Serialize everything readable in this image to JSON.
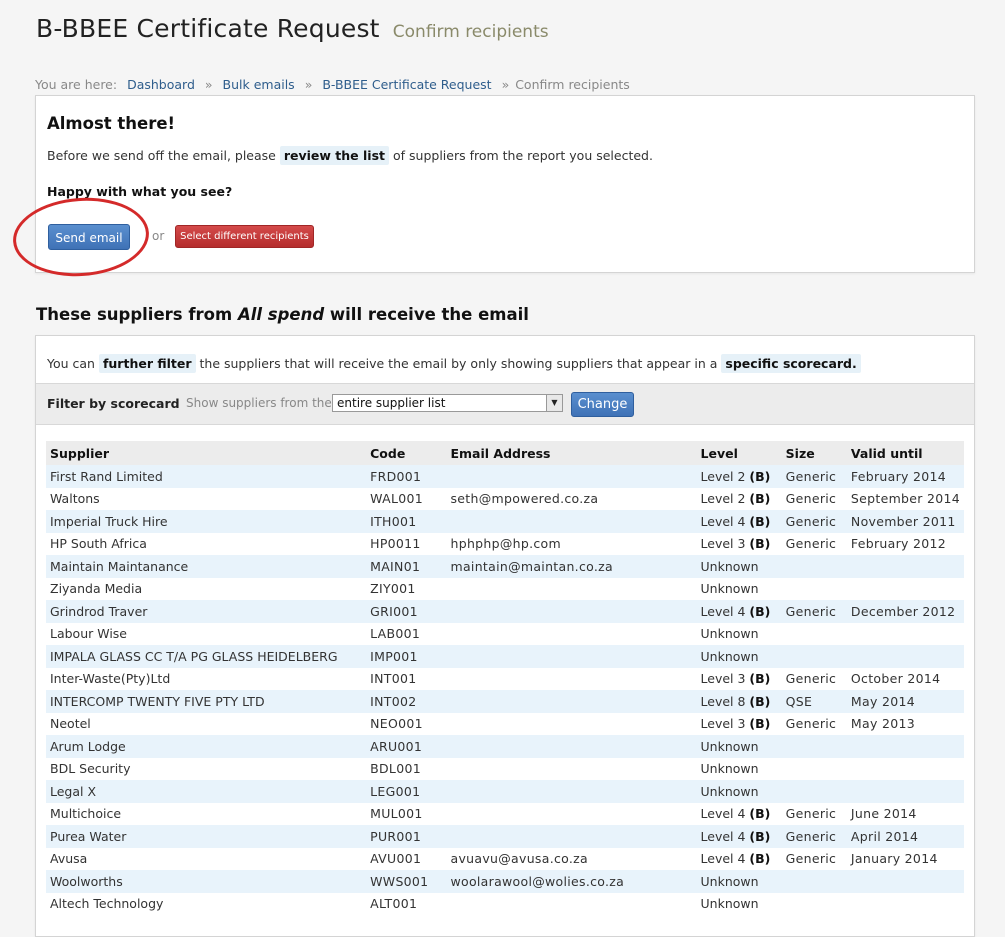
{
  "page": {
    "title": "B-BBEE Certificate Request",
    "subtitle": "Confirm recipients"
  },
  "breadcrumb": {
    "prefix": "You are here:",
    "items": [
      "Dashboard",
      "Bulk emails",
      "B-BBEE Certificate Request"
    ],
    "current": "Confirm recipients",
    "separator": "»"
  },
  "confirm": {
    "heading": "Almost there!",
    "text_before": "Before we send off the email, please",
    "highlight": "review the list",
    "text_after": "of suppliers from the report you selected.",
    "question": "Happy with what you see?",
    "send_label": "Send email",
    "or_label": "or",
    "different_label": "Select different recipients"
  },
  "suppliers_section": {
    "title_before": "These suppliers from",
    "title_em": "All spend",
    "title_after": "will receive the email"
  },
  "filter_note": {
    "text_before": "You can",
    "hl1": "further filter",
    "text_mid": "the suppliers that will receive the email by only showing suppliers that appear in a",
    "hl2": "specific scorecard",
    "text_end": "."
  },
  "filter": {
    "label": "Filter by scorecard",
    "show_text": "Show suppliers from the",
    "selected": "entire supplier list",
    "change_label": "Change"
  },
  "table": {
    "headers": [
      "Supplier",
      "Code",
      "Email Address",
      "Level",
      "Size",
      "Valid until"
    ],
    "rows": [
      {
        "supplier": "First Rand Limited",
        "code": "FRD001",
        "email": "",
        "level": "Level 2",
        "grade": "(B)",
        "size": "Generic",
        "valid": "February 2014"
      },
      {
        "supplier": "Waltons",
        "code": "WAL001",
        "email": "seth@mpowered.co.za",
        "level": "Level 2",
        "grade": "(B)",
        "size": "Generic",
        "valid": "September 2014"
      },
      {
        "supplier": "Imperial Truck Hire",
        "code": "ITH001",
        "email": "",
        "level": "Level 4",
        "grade": "(B)",
        "size": "Generic",
        "valid": "November 2011"
      },
      {
        "supplier": "HP South Africa",
        "code": "HP0011",
        "email": "hphphp@hp.com",
        "level": "Level 3",
        "grade": "(B)",
        "size": "Generic",
        "valid": "February 2012"
      },
      {
        "supplier": "Maintain Maintanance",
        "code": "MAIN01",
        "email": "maintain@maintan.co.za",
        "level": "Unknown",
        "grade": "",
        "size": "",
        "valid": ""
      },
      {
        "supplier": "Ziyanda Media",
        "code": "ZIY001",
        "email": "",
        "level": "Unknown",
        "grade": "",
        "size": "",
        "valid": ""
      },
      {
        "supplier": "Grindrod Traver",
        "code": "GRI001",
        "email": "",
        "level": "Level 4",
        "grade": "(B)",
        "size": "Generic",
        "valid": "December 2012"
      },
      {
        "supplier": "Labour Wise",
        "code": "LAB001",
        "email": "",
        "level": "Unknown",
        "grade": "",
        "size": "",
        "valid": ""
      },
      {
        "supplier": "IMPALA GLASS CC T/A PG GLASS HEIDELBERG",
        "code": "IMP001",
        "email": "",
        "level": "Unknown",
        "grade": "",
        "size": "",
        "valid": ""
      },
      {
        "supplier": "Inter-Waste(Pty)Ltd",
        "code": "INT001",
        "email": "",
        "level": "Level 3",
        "grade": "(B)",
        "size": "Generic",
        "valid": "October 2014"
      },
      {
        "supplier": "INTERCOMP TWENTY FIVE PTY LTD",
        "code": "INT002",
        "email": "",
        "level": "Level 8",
        "grade": "(B)",
        "size": "QSE",
        "valid": "May 2014"
      },
      {
        "supplier": "Neotel",
        "code": "NEO001",
        "email": "",
        "level": "Level 3",
        "grade": "(B)",
        "size": "Generic",
        "valid": "May 2013"
      },
      {
        "supplier": "Arum Lodge",
        "code": "ARU001",
        "email": "",
        "level": "Unknown",
        "grade": "",
        "size": "",
        "valid": ""
      },
      {
        "supplier": "BDL Security",
        "code": "BDL001",
        "email": "",
        "level": "Unknown",
        "grade": "",
        "size": "",
        "valid": ""
      },
      {
        "supplier": "Legal X",
        "code": "LEG001",
        "email": "",
        "level": "Unknown",
        "grade": "",
        "size": "",
        "valid": ""
      },
      {
        "supplier": "Multichoice",
        "code": "MUL001",
        "email": "",
        "level": "Level 4",
        "grade": "(B)",
        "size": "Generic",
        "valid": "June 2014"
      },
      {
        "supplier": "Purea Water",
        "code": "PUR001",
        "email": "",
        "level": "Level 4",
        "grade": "(B)",
        "size": "Generic",
        "valid": "April 2014"
      },
      {
        "supplier": "Avusa",
        "code": "AVU001",
        "email": "avuavu@avusa.co.za",
        "level": "Level 4",
        "grade": "(B)",
        "size": "Generic",
        "valid": "January 2014"
      },
      {
        "supplier": "Woolworths",
        "code": "WWS001",
        "email": "woolarawool@wolies.co.za",
        "level": "Unknown",
        "grade": "",
        "size": "",
        "valid": ""
      },
      {
        "supplier": "Altech Technology",
        "code": "ALT001",
        "email": "",
        "level": "Unknown",
        "grade": "",
        "size": "",
        "valid": ""
      }
    ]
  },
  "colors": {
    "link": "#2e5d8c",
    "primary_button": "#3f72b6",
    "danger_button": "#b52d2d",
    "row_stripe": "#e8f3fb",
    "annotation_circle": "#d42a2a"
  }
}
